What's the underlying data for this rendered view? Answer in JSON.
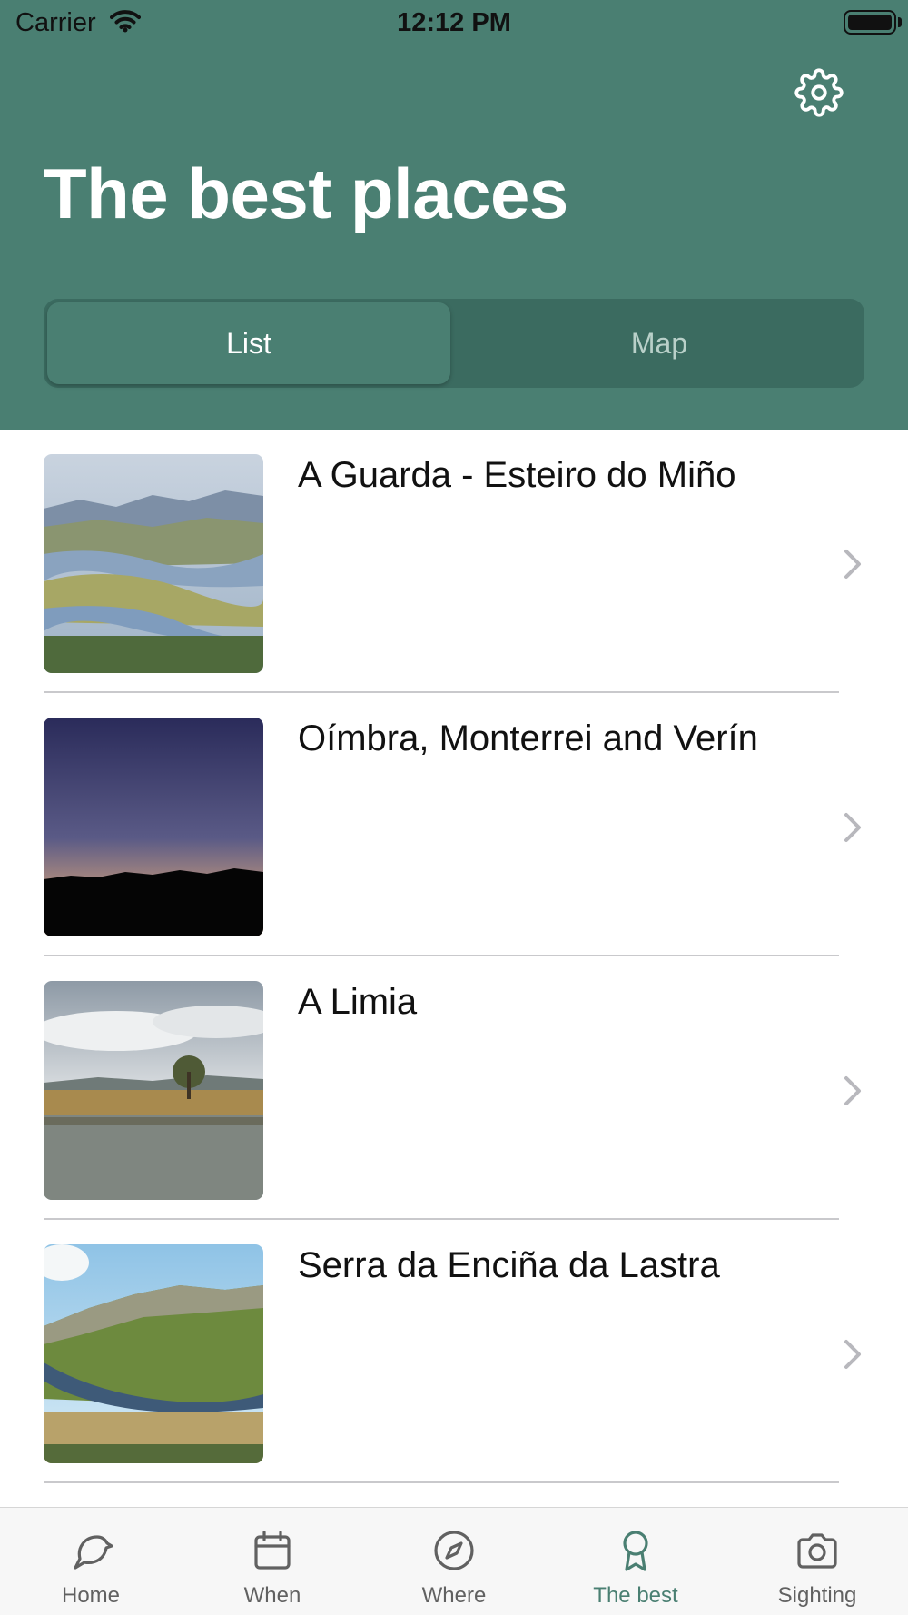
{
  "status_bar": {
    "carrier": "Carrier",
    "time": "12:12 PM"
  },
  "header": {
    "title": "The best places",
    "settings_icon": "gear-icon"
  },
  "segmented": {
    "list_label": "List",
    "map_label": "Map",
    "selected": "List"
  },
  "places": [
    {
      "title": "A Guarda - Esteiro do Miño"
    },
    {
      "title": "Oímbra, Monterrei and Verín"
    },
    {
      "title": "A Limia"
    },
    {
      "title": "Serra da Enciña da Lastra"
    }
  ],
  "tabbar": {
    "items": [
      {
        "label": "Home",
        "icon": "bird-icon"
      },
      {
        "label": "When",
        "icon": "calendar-icon"
      },
      {
        "label": "Where",
        "icon": "compass-icon"
      },
      {
        "label": "The best",
        "icon": "award-icon"
      },
      {
        "label": "Sighting",
        "icon": "camera-icon"
      }
    ],
    "active": "The best"
  },
  "colors": {
    "accent": "#4a7f72",
    "segment_bg": "#3b6b60",
    "inactive_tab": "#616161"
  }
}
